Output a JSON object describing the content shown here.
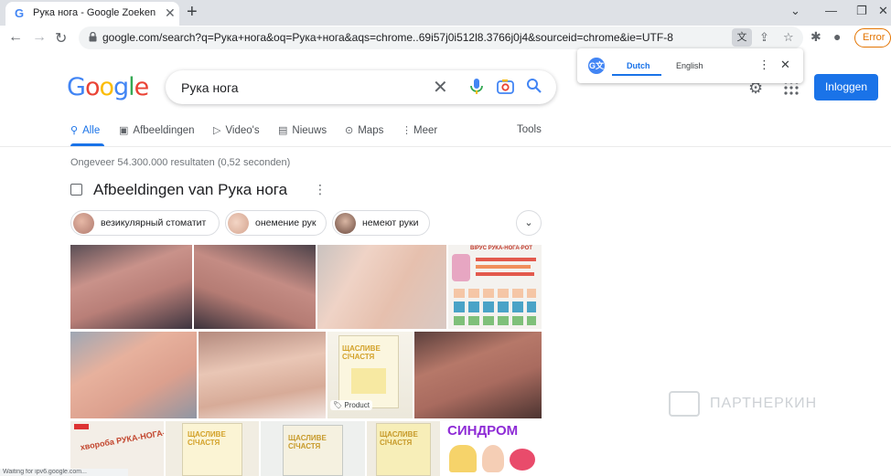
{
  "browser": {
    "tab_title": "Рука нога - Google Zoeken",
    "tab_favicon": "G",
    "new_tab_icon": "+",
    "url": "google.com/search?q=Рука+нога&oq=Рука+нога&aqs=chrome..69i57j0i512l8.3766j0j4&sourceid=chrome&ie=UTF-8",
    "error_label": "Error",
    "status_text": "Waiting for ipv6.google.com..."
  },
  "translate": {
    "from_lang": "Dutch",
    "to_lang": "English"
  },
  "google": {
    "logo_letters": [
      {
        "ch": "G",
        "color": "#4285f4"
      },
      {
        "ch": "o",
        "color": "#ea4335"
      },
      {
        "ch": "o",
        "color": "#fbbc05"
      },
      {
        "ch": "g",
        "color": "#4285f4"
      },
      {
        "ch": "l",
        "color": "#34a853"
      },
      {
        "ch": "e",
        "color": "#ea4335"
      }
    ],
    "query": "Рука нога",
    "login_label": "Inloggen",
    "tabs": [
      {
        "label": "Alle",
        "icon": "search-icon",
        "active": true
      },
      {
        "label": "Afbeeldingen",
        "icon": "image-icon"
      },
      {
        "label": "Video's",
        "icon": "play-icon"
      },
      {
        "label": "Nieuws",
        "icon": "news-icon"
      },
      {
        "label": "Maps",
        "icon": "pin-icon"
      },
      {
        "label": "Meer",
        "icon": "more-vert-icon"
      }
    ],
    "tools_label": "Tools",
    "result_stats": "Ongeveer 54.300.000 resultaten (0,52 seconden)",
    "images_heading": "Afbeeldingen van Рука нога",
    "chips": [
      {
        "label": "везикулярный стоматит"
      },
      {
        "label": "онемение рук"
      },
      {
        "label": "немеют руки"
      }
    ],
    "product_badge": "Product",
    "thumb_texts": {
      "sign_top": "ВІРУС РУКА-НОГА-РОТ",
      "pack": "ЩАСЛИВЕ СІЧАСТЯ",
      "kids": "хвороба РУКА-НОГА-РОТ",
      "syndrome": "СИНДРОМ"
    }
  },
  "watermark_text": "ПАРТНЕРКИН",
  "accent_color": "#1a73e8"
}
